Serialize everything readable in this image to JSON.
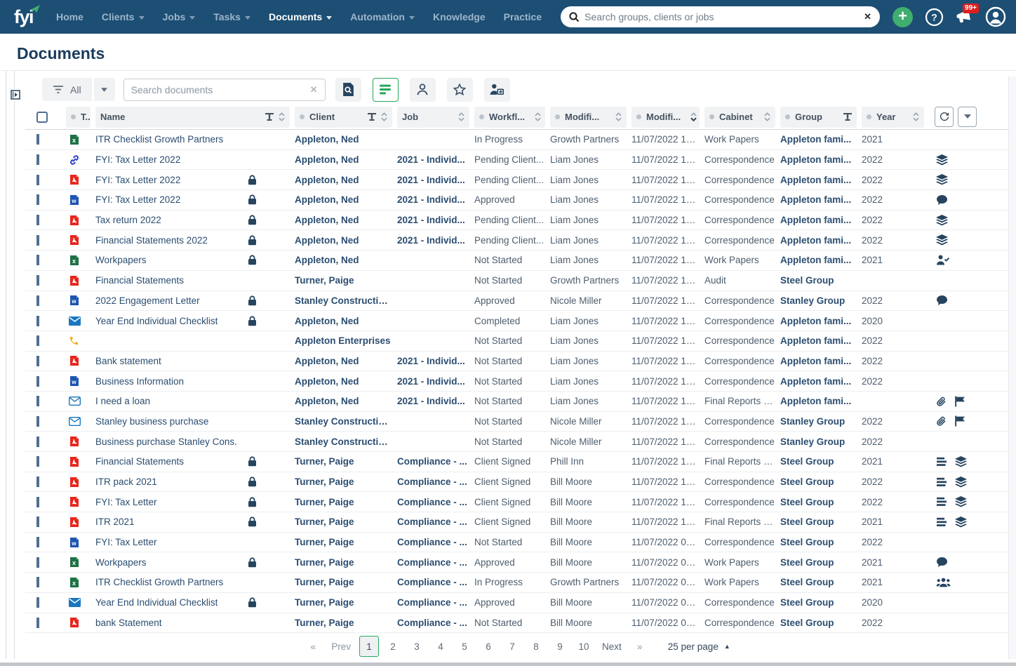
{
  "topbar": {
    "logo": "fyi",
    "nav": [
      {
        "label": "Home",
        "caret": false,
        "active": false
      },
      {
        "label": "Clients",
        "caret": true,
        "active": false
      },
      {
        "label": "Jobs",
        "caret": true,
        "active": false
      },
      {
        "label": "Tasks",
        "caret": true,
        "active": false
      },
      {
        "label": "Documents",
        "caret": true,
        "active": true
      },
      {
        "label": "Automation",
        "caret": true,
        "active": false
      },
      {
        "label": "Knowledge",
        "caret": false,
        "active": false
      },
      {
        "label": "Practice",
        "caret": false,
        "active": false
      }
    ],
    "search_placeholder": "Search groups, clients or jobs",
    "notification_badge": "99+"
  },
  "page": {
    "title": "Documents"
  },
  "toolbar": {
    "filter_label": "All",
    "search_placeholder": "Search documents"
  },
  "table": {
    "columns": [
      {
        "label": "T...",
        "dot": true,
        "filter": false,
        "sort": false
      },
      {
        "label": "Name",
        "dot": false,
        "filter": true,
        "sort": true
      },
      {
        "label": "Client",
        "dot": true,
        "filter": true,
        "sort": true
      },
      {
        "label": "Job",
        "dot": false,
        "filter": false,
        "sort": true
      },
      {
        "label": "Workfl...",
        "dot": true,
        "filter": false,
        "sort": true
      },
      {
        "label": "Modifi...",
        "dot": true,
        "filter": false,
        "sort": true
      },
      {
        "label": "Modifi...",
        "dot": true,
        "filter": false,
        "sort": true,
        "sorted": "desc"
      },
      {
        "label": "Cabinet",
        "dot": true,
        "filter": false,
        "sort": true
      },
      {
        "label": "Group",
        "dot": true,
        "filter": true,
        "sort": false
      },
      {
        "label": "Year",
        "dot": true,
        "filter": false,
        "sort": true
      }
    ],
    "rows": [
      {
        "type": "excel",
        "name": "ITR Checklist Growth Partners",
        "locked": false,
        "client": "Appleton, Ned",
        "job": "",
        "workflow": "In Progress",
        "modified_by": "Growth Partners",
        "modified_date": "11/07/2022 13...",
        "cabinet": "Work Papers",
        "group": "Appleton fami...",
        "year": "2021",
        "icons": []
      },
      {
        "type": "link",
        "name": "FYI: Tax Letter 2022",
        "locked": false,
        "client": "Appleton, Ned",
        "job": "2021 - Individ...",
        "workflow": "Pending Client...",
        "modified_by": "Liam Jones",
        "modified_date": "11/07/2022 12...",
        "cabinet": "Correspondence",
        "group": "Appleton fami...",
        "year": "2022",
        "icons": [
          "layers"
        ]
      },
      {
        "type": "pdf",
        "name": "FYI: Tax Letter 2022",
        "locked": true,
        "client": "Appleton, Ned",
        "job": "2021 - Individ...",
        "workflow": "Pending Client...",
        "modified_by": "Liam Jones",
        "modified_date": "11/07/2022 12...",
        "cabinet": "Correspondence",
        "group": "Appleton fami...",
        "year": "2022",
        "icons": [
          "layers"
        ]
      },
      {
        "type": "word",
        "name": "FYI: Tax Letter 2022",
        "locked": true,
        "client": "Appleton, Ned",
        "job": "2021 - Individ...",
        "workflow": "Approved",
        "modified_by": "Liam Jones",
        "modified_date": "11/07/2022 12...",
        "cabinet": "Correspondence",
        "group": "Appleton fami...",
        "year": "2022",
        "icons": [
          "comment"
        ]
      },
      {
        "type": "pdf",
        "name": "Tax return 2022",
        "locked": true,
        "client": "Appleton, Ned",
        "job": "2021 - Individ...",
        "workflow": "Pending Client...",
        "modified_by": "Liam Jones",
        "modified_date": "11/07/2022 12...",
        "cabinet": "Correspondence",
        "group": "Appleton fami...",
        "year": "2022",
        "icons": [
          "layers"
        ]
      },
      {
        "type": "pdf",
        "name": "Financial Statements 2022",
        "locked": true,
        "client": "Appleton, Ned",
        "job": "2021 - Individ...",
        "workflow": "Pending Client...",
        "modified_by": "Liam Jones",
        "modified_date": "11/07/2022 12...",
        "cabinet": "Correspondence",
        "group": "Appleton fami...",
        "year": "2022",
        "icons": [
          "layers"
        ]
      },
      {
        "type": "excel",
        "name": "Workpapers",
        "locked": true,
        "client": "Appleton, Ned",
        "job": "",
        "workflow": "Not Started",
        "modified_by": "Liam Jones",
        "modified_date": "11/07/2022 12...",
        "cabinet": "Work Papers",
        "group": "Appleton fami...",
        "year": "2021",
        "icons": [
          "person-check"
        ]
      },
      {
        "type": "pdf",
        "name": "Financial Statements",
        "locked": false,
        "client": "Turner, Paige",
        "job": "",
        "workflow": "Not Started",
        "modified_by": "Growth Partners",
        "modified_date": "11/07/2022 12...",
        "cabinet": "Audit",
        "group": "Steel Group",
        "year": "",
        "icons": []
      },
      {
        "type": "word",
        "name": "2022 Engagement Letter",
        "locked": true,
        "client": "Stanley Constructio...",
        "job": "",
        "workflow": "Approved",
        "modified_by": "Nicole Miller",
        "modified_date": "11/07/2022 12...",
        "cabinet": "Correspondence",
        "group": "Stanley Group",
        "year": "2022",
        "icons": [
          "comment"
        ]
      },
      {
        "type": "email",
        "name": "Year End Individual Checklist",
        "locked": true,
        "client": "Appleton, Ned",
        "job": "",
        "workflow": "Completed",
        "modified_by": "Liam Jones",
        "modified_date": "11/07/2022 12...",
        "cabinet": "Correspondence",
        "group": "Appleton fami...",
        "year": "2020",
        "icons": []
      },
      {
        "type": "phone",
        "name": "",
        "locked": false,
        "client": "Appleton Enterprises",
        "job": "",
        "workflow": "Not Started",
        "modified_by": "Liam Jones",
        "modified_date": "11/07/2022 12...",
        "cabinet": "Correspondence",
        "group": "Appleton fami...",
        "year": "2022",
        "icons": []
      },
      {
        "type": "pdf",
        "name": "Bank statement",
        "locked": false,
        "client": "Appleton, Ned",
        "job": "2021 - Individ...",
        "workflow": "Not Started",
        "modified_by": "Liam Jones",
        "modified_date": "11/07/2022 12...",
        "cabinet": "Correspondence",
        "group": "Appleton fami...",
        "year": "2022",
        "icons": []
      },
      {
        "type": "word",
        "name": "Business Information",
        "locked": false,
        "client": "Appleton, Ned",
        "job": "2021 - Individ...",
        "workflow": "Not Started",
        "modified_by": "Liam Jones",
        "modified_date": "11/07/2022 12...",
        "cabinet": "Correspondence",
        "group": "Appleton fami...",
        "year": "2022",
        "icons": []
      },
      {
        "type": "email-outline",
        "name": "I need a loan",
        "locked": false,
        "client": "Appleton, Ned",
        "job": "2021 - Individ...",
        "workflow": "Not Started",
        "modified_by": "Liam Jones",
        "modified_date": "11/07/2022 12...",
        "cabinet": "Final Reports a...",
        "group": "Appleton fami...",
        "year": "",
        "icons": [
          "paperclip",
          "flag"
        ]
      },
      {
        "type": "email-outline",
        "name": "Stanley business purchase",
        "locked": false,
        "client": "Stanley Constructio...",
        "job": "",
        "workflow": "Not Started",
        "modified_by": "Nicole Miller",
        "modified_date": "11/07/2022 12...",
        "cabinet": "Correspondence",
        "group": "Stanley Group",
        "year": "2022",
        "icons": [
          "paperclip",
          "flag"
        ]
      },
      {
        "type": "pdf",
        "name": "Business purchase Stanley Cons.",
        "locked": false,
        "client": "Stanley Constructio...",
        "job": "",
        "workflow": "Not Started",
        "modified_by": "Nicole Miller",
        "modified_date": "11/07/2022 12...",
        "cabinet": "Correspondence",
        "group": "Stanley Group",
        "year": "2022",
        "icons": []
      },
      {
        "type": "pdf",
        "name": "Financial Statements",
        "locked": true,
        "client": "Turner, Paige",
        "job": "Compliance - ...",
        "workflow": "Client Signed",
        "modified_by": "Phill Inn",
        "modified_date": "11/07/2022 10...",
        "cabinet": "Final Reports a...",
        "group": "Steel Group",
        "year": "2021",
        "icons": [
          "lines",
          "layers"
        ]
      },
      {
        "type": "pdf",
        "name": "ITR pack 2021",
        "locked": true,
        "client": "Turner, Paige",
        "job": "Compliance - ...",
        "workflow": "Client Signed",
        "modified_by": "Bill Moore",
        "modified_date": "11/07/2022 10...",
        "cabinet": "Correspondence",
        "group": "Steel Group",
        "year": "2022",
        "icons": [
          "lines",
          "layers"
        ]
      },
      {
        "type": "pdf",
        "name": "FYI: Tax Letter",
        "locked": true,
        "client": "Turner, Paige",
        "job": "Compliance - ...",
        "workflow": "Client Signed",
        "modified_by": "Bill Moore",
        "modified_date": "11/07/2022 10...",
        "cabinet": "Correspondence",
        "group": "Steel Group",
        "year": "2022",
        "icons": [
          "lines",
          "layers"
        ]
      },
      {
        "type": "pdf",
        "name": "ITR 2021",
        "locked": true,
        "client": "Turner, Paige",
        "job": "Compliance - ...",
        "workflow": "Client Signed",
        "modified_by": "Bill Moore",
        "modified_date": "11/07/2022 10...",
        "cabinet": "Final Reports a...",
        "group": "Steel Group",
        "year": "2021",
        "icons": [
          "lines",
          "layers"
        ]
      },
      {
        "type": "word",
        "name": "FYI: Tax Letter",
        "locked": false,
        "client": "Turner, Paige",
        "job": "Compliance - ...",
        "workflow": "Not Started",
        "modified_by": "Bill Moore",
        "modified_date": "11/07/2022 09...",
        "cabinet": "Correspondence",
        "group": "Steel Group",
        "year": "2022",
        "icons": []
      },
      {
        "type": "excel",
        "name": "Workpapers",
        "locked": true,
        "client": "Turner, Paige",
        "job": "Compliance - ...",
        "workflow": "Approved",
        "modified_by": "Bill Moore",
        "modified_date": "11/07/2022 09...",
        "cabinet": "Work Papers",
        "group": "Steel Group",
        "year": "2021",
        "icons": [
          "comment"
        ]
      },
      {
        "type": "excel",
        "name": "ITR Checklist Growth Partners",
        "locked": false,
        "client": "Turner, Paige",
        "job": "Compliance - ...",
        "workflow": "In Progress",
        "modified_by": "Growth Partners",
        "modified_date": "11/07/2022 09...",
        "cabinet": "Work Papers",
        "group": "Steel Group",
        "year": "2021",
        "icons": [
          "people"
        ]
      },
      {
        "type": "email",
        "name": "Year End Individual Checklist",
        "locked": true,
        "client": "Turner, Paige",
        "job": "Compliance - ...",
        "workflow": "Approved",
        "modified_by": "Bill Moore",
        "modified_date": "11/07/2022 09...",
        "cabinet": "Correspondence",
        "group": "Steel Group",
        "year": "2020",
        "icons": []
      },
      {
        "type": "pdf",
        "name": "bank Statement",
        "locked": false,
        "client": "Turner, Paige",
        "job": "Compliance - ...",
        "workflow": "Not Started",
        "modified_by": "Bill Moore",
        "modified_date": "11/07/2022 09...",
        "cabinet": "Correspondence",
        "group": "Steel Group",
        "year": "2022",
        "icons": []
      }
    ]
  },
  "pagination": {
    "first": "«",
    "prev": "Prev",
    "pages": [
      "1",
      "2",
      "3",
      "4",
      "5",
      "6",
      "7",
      "8",
      "9",
      "10"
    ],
    "active_page": "1",
    "next": "Next",
    "last": "»",
    "per_page": "25 per page"
  },
  "colors": {
    "topbar": "#1d4e74",
    "accent_green": "#27a65a",
    "navy": "#2b4d70",
    "badge_red": "#e01e1e"
  }
}
